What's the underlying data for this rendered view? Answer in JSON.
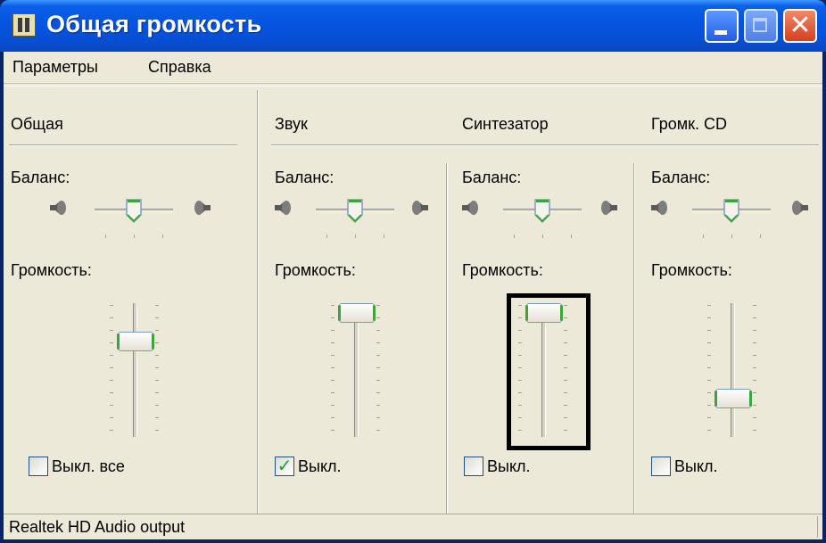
{
  "window": {
    "title": "Общая громкость"
  },
  "menu": [
    {
      "label": "Параметры"
    },
    {
      "label": "Справка"
    }
  ],
  "columns": [
    {
      "name": "Общая",
      "balance_label": "Баланс:",
      "volume_label": "Громкость:",
      "mute_label": "Выкл. все",
      "muted": false,
      "balance": 0.5,
      "volume": 0.75
    },
    {
      "name": "Звук",
      "balance_label": "Баланс:",
      "volume_label": "Громкость:",
      "mute_label": "Выкл.",
      "muted": true,
      "balance": 0.5,
      "volume": 1.0
    },
    {
      "name": "Синтезатор",
      "balance_label": "Баланс:",
      "volume_label": "Громкость:",
      "mute_label": "Выкл.",
      "muted": false,
      "balance": 0.5,
      "volume": 1.0
    },
    {
      "name": "Громк. CD",
      "balance_label": "Баланс:",
      "volume_label": "Громкость:",
      "mute_label": "Выкл.",
      "muted": false,
      "balance": 0.5,
      "volume": 0.25
    }
  ],
  "status": {
    "text": "Realtek HD Audio output"
  },
  "colors": {
    "titlebar": "#0554e0",
    "client": "#ece9d8",
    "thumb_accent": "#3ea33b",
    "check": "#21a121",
    "highlight": "#000000"
  }
}
